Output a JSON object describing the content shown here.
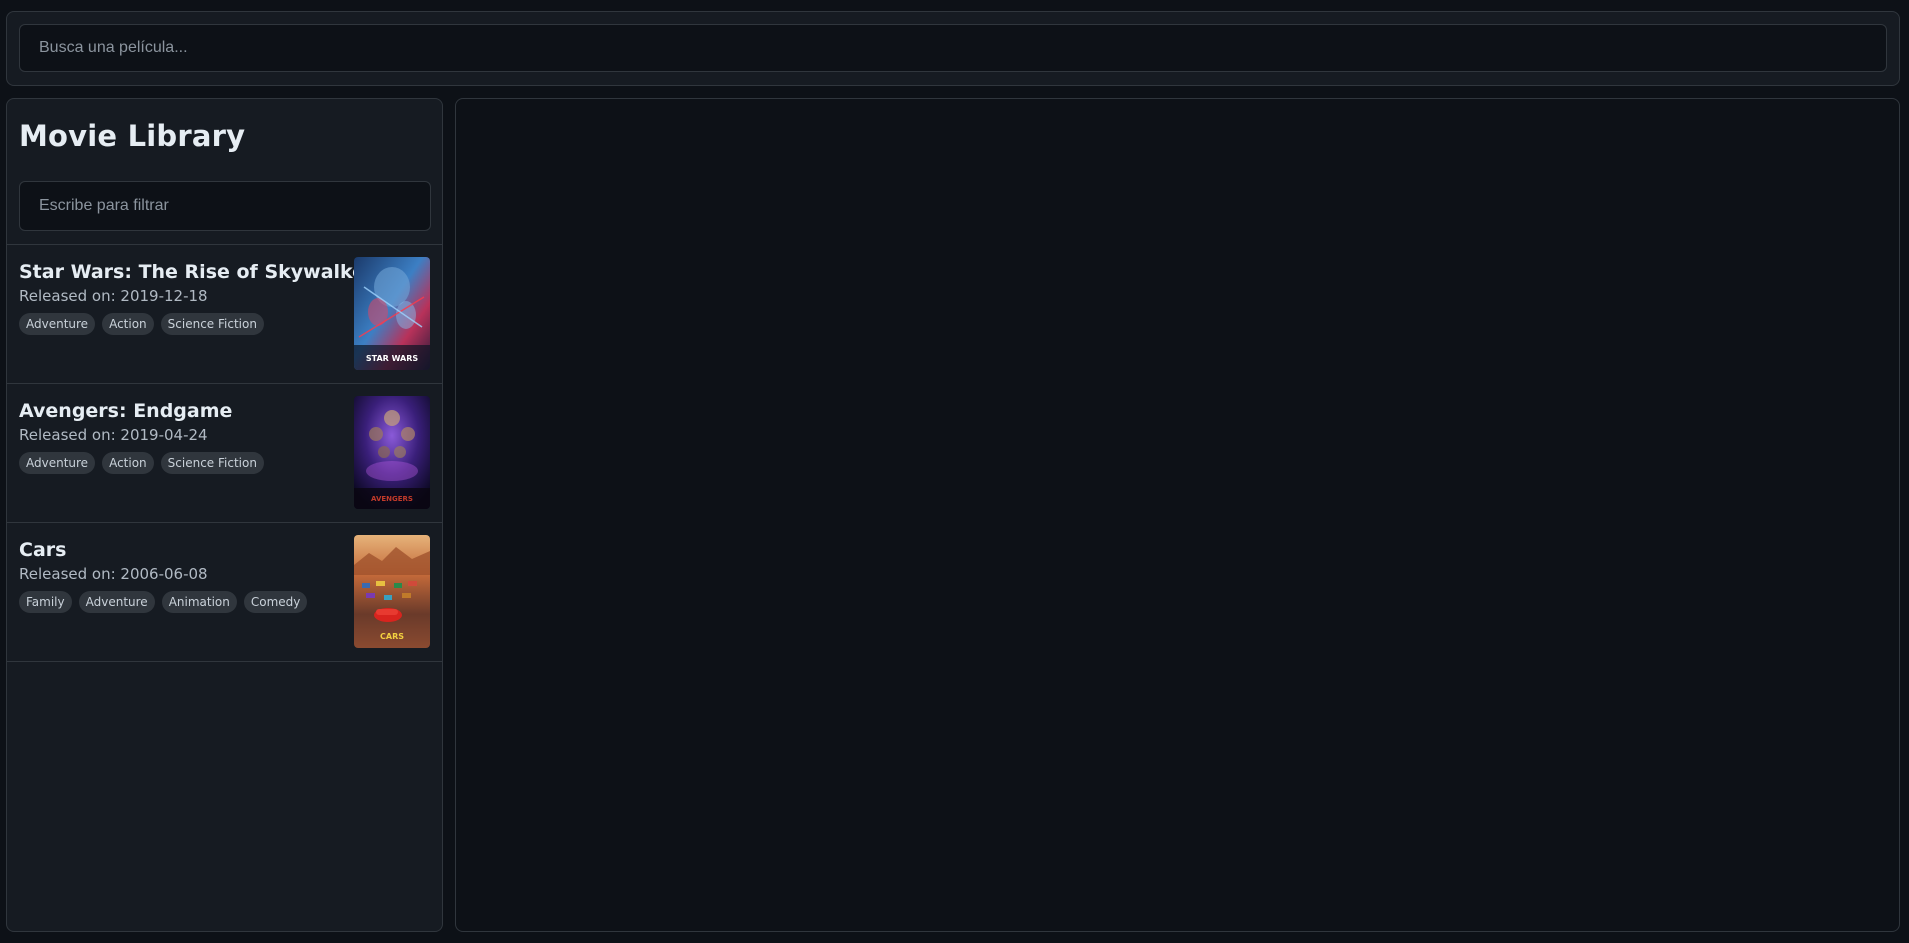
{
  "search": {
    "placeholder": "Busca una película..."
  },
  "sidebar": {
    "title": "Movie Library",
    "filter_placeholder": "Escribe para filtrar"
  },
  "movies": [
    {
      "title": "Star Wars: The Rise of Skywalker",
      "released": "Released on: 2019-12-18",
      "genres": [
        "Adventure",
        "Action",
        "Science Fiction"
      ],
      "poster_text": "STAR WARS"
    },
    {
      "title": "Avengers: Endgame",
      "released": "Released on: 2019-04-24",
      "genres": [
        "Adventure",
        "Action",
        "Science Fiction"
      ],
      "poster_text": "AVENGERS"
    },
    {
      "title": "Cars",
      "released": "Released on: 2006-06-08",
      "genres": [
        "Family",
        "Adventure",
        "Animation",
        "Comedy"
      ],
      "poster_text": "CARS"
    }
  ],
  "colors": {
    "background": "#0d1117",
    "panel": "#161b22",
    "border": "#30363d",
    "tag": "#30363d"
  }
}
